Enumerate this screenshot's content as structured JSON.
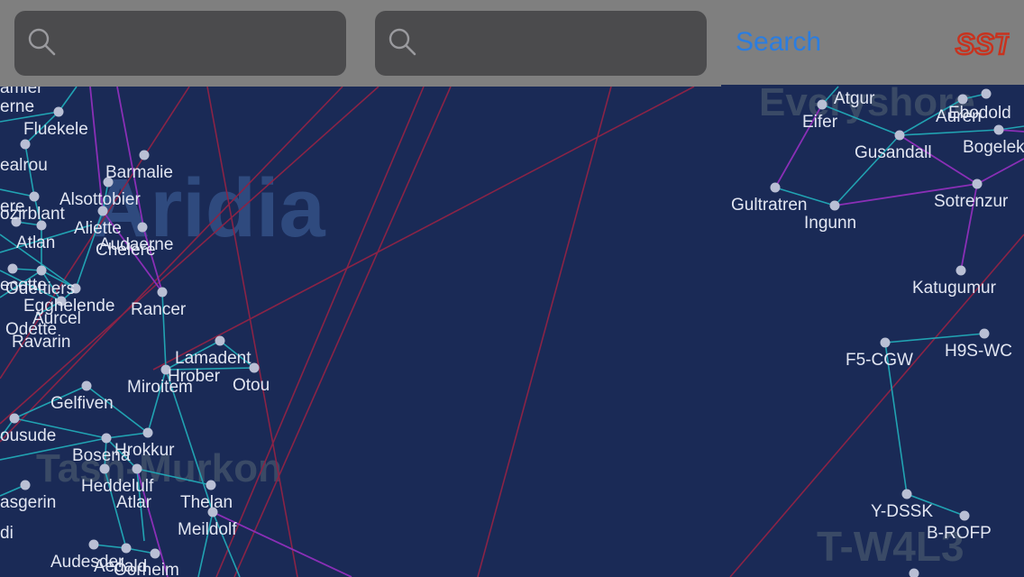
{
  "header": {
    "search_left_placeholder": "",
    "search_right_placeholder": "",
    "search_button_label": "Search",
    "logo_text": "SST"
  },
  "colors": {
    "map_background": "#1a2a56",
    "header_background": "#7f7f7f",
    "search_field": "#4b4b4d",
    "accent_blue": "#2b7de0",
    "logo_red": "#c8321e",
    "teal_link": "#21a3b2",
    "purple_link": "#8a2fb6",
    "red_link": "#8a2346",
    "node": "#b9bfd4"
  },
  "regions": [
    {
      "name": "Aridia"
    },
    {
      "name": "Tash-Murkon"
    },
    {
      "name": "Everyshore"
    },
    {
      "name": "T-W4L3"
    }
  ],
  "systems": [
    "amier",
    "erne",
    "Fluekele",
    "ealrou",
    "Barmalie",
    "Alsottobier",
    "ere",
    "ozirblant",
    "Aliette",
    "Atlan",
    "Audaerne",
    "Chelere",
    "ecette",
    "Odettiers",
    "Egghelende",
    "Aurcel",
    "Odette",
    "Ravarin",
    "Rancer",
    "Lamadent",
    "Hrober",
    "Miroitem",
    "Otou",
    "Gelfiven",
    "ousude",
    "Bosena",
    "Hrokkur",
    "Heddelulf",
    "Atlar",
    "Thelan",
    "asgerin",
    "Meildolf",
    "Audesder",
    "Aedald",
    "Oorheim",
    "Atgur",
    "Eifer",
    "Auren",
    "Ebodold",
    "Gusandall",
    "Bogelek",
    "Gultratren",
    "Ingunn",
    "Sotrenzur",
    "Katugumur",
    "F5-CGW",
    "H9S-WC",
    "Y-DSSK",
    "B-ROFP",
    "di"
  ]
}
